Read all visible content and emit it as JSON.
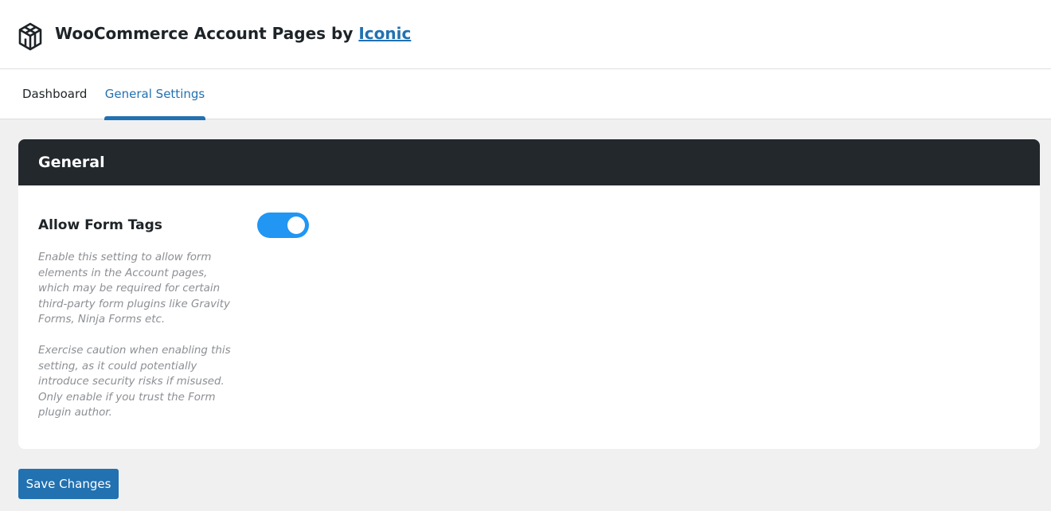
{
  "header": {
    "logo_icon": "iconic-cube-logo-icon",
    "title_prefix": "WooCommerce Account Pages by",
    "brand_link": "Iconic"
  },
  "tabs": [
    {
      "label": "Dashboard",
      "active": false
    },
    {
      "label": "General Settings",
      "active": true
    }
  ],
  "panel": {
    "title": "General",
    "setting": {
      "label": "Allow Form Tags",
      "description_1": "Enable this setting to allow form elements in the Account pages, which may be required for certain third-party form plugins like Gravity Forms, Ninja Forms etc.",
      "description_2": "Exercise caution when enabling this setting, as it could potentially introduce security risks if misused. Only enable if you trust the Form plugin author.",
      "enabled": true
    }
  },
  "save_label": "Save Changes",
  "colors": {
    "accent": "#2271b1",
    "toggle_on": "#2196f3",
    "panel_header": "#23282d",
    "background": "#f0f0f1"
  }
}
